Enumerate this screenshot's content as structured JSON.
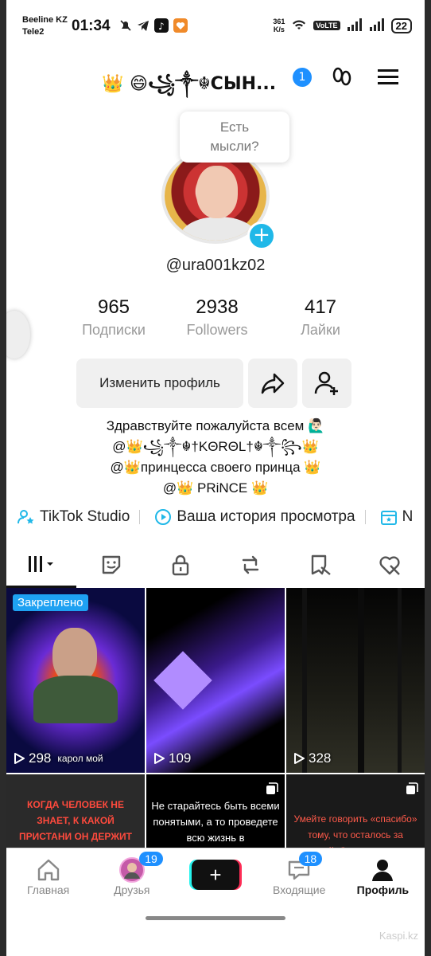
{
  "status_bar": {
    "carrier_1": "Beeline KZ",
    "carrier_2": "Tele2",
    "time": "01:34",
    "network_speed_top": "361",
    "network_speed_unit": "K/s",
    "volte": "VoLTE",
    "battery": "22"
  },
  "header": {
    "profile_name": "👑 😄꧁༒☬СЫН...",
    "notification_count": "1"
  },
  "bubble": {
    "line1": "Есть",
    "line2": "мысли?"
  },
  "profile": {
    "handle": "@ura001kz02"
  },
  "stats": [
    {
      "value": "965",
      "label": "Подписки"
    },
    {
      "value": "2938",
      "label": "Followers"
    },
    {
      "value": "417",
      "label": "Лайки"
    }
  ],
  "actions": {
    "edit_profile": "Изменить профиль"
  },
  "bio": {
    "line1": "Здравствуйте пожалуйста всем 🙋🏻‍♂️",
    "line2": "@👑꧁༒☬†KΘRΘL†☬༒꧂👑",
    "line3": "@👑принцесса своего принца 👑",
    "line4": "@👑 PRiNCE 👑"
  },
  "links": {
    "studio": "TikTok Studio",
    "history": "Ваша история просмотра",
    "third_partial": "N"
  },
  "grid": {
    "pinned_label": "Закреплено",
    "row1": [
      {
        "views": "298",
        "overlay": "карол мой",
        "colors": [
          "#0a0a40",
          "#6a2bd6",
          "#e84a1e"
        ]
      },
      {
        "views": "109",
        "colors": [
          "#000000",
          "#3a1a8a",
          "#9b6cff"
        ]
      },
      {
        "views": "328",
        "colors": [
          "#050505",
          "#1c1c16",
          "#2f2f25"
        ]
      }
    ],
    "row2": [
      {
        "caption": "Когда человек не знает, к какой пристани он держит путь, для него",
        "bg": "#2a2a2a",
        "fg": "#ff4a3d"
      },
      {
        "caption": "Не старайтесь быть всеми понятыми, а то проведете всю жизнь в",
        "bg": "#000000",
        "fg": "#ffffff"
      },
      {
        "caption": "Умейте говорить «спасибо» тому, что осталось за спиной. Оно наполнило",
        "bg": "#1a1a1a",
        "fg": "#ff5a4a"
      }
    ]
  },
  "nav": [
    {
      "label": "Главная",
      "icon": "home-icon"
    },
    {
      "label": "Друзья",
      "icon": "friends-avatar",
      "badge": "19"
    },
    {
      "label": "",
      "icon": "create-icon"
    },
    {
      "label": "Входящие",
      "icon": "inbox-icon",
      "badge": "18"
    },
    {
      "label": "Профиль",
      "icon": "profile-icon"
    }
  ],
  "watermark": "Kaspi.kz"
}
